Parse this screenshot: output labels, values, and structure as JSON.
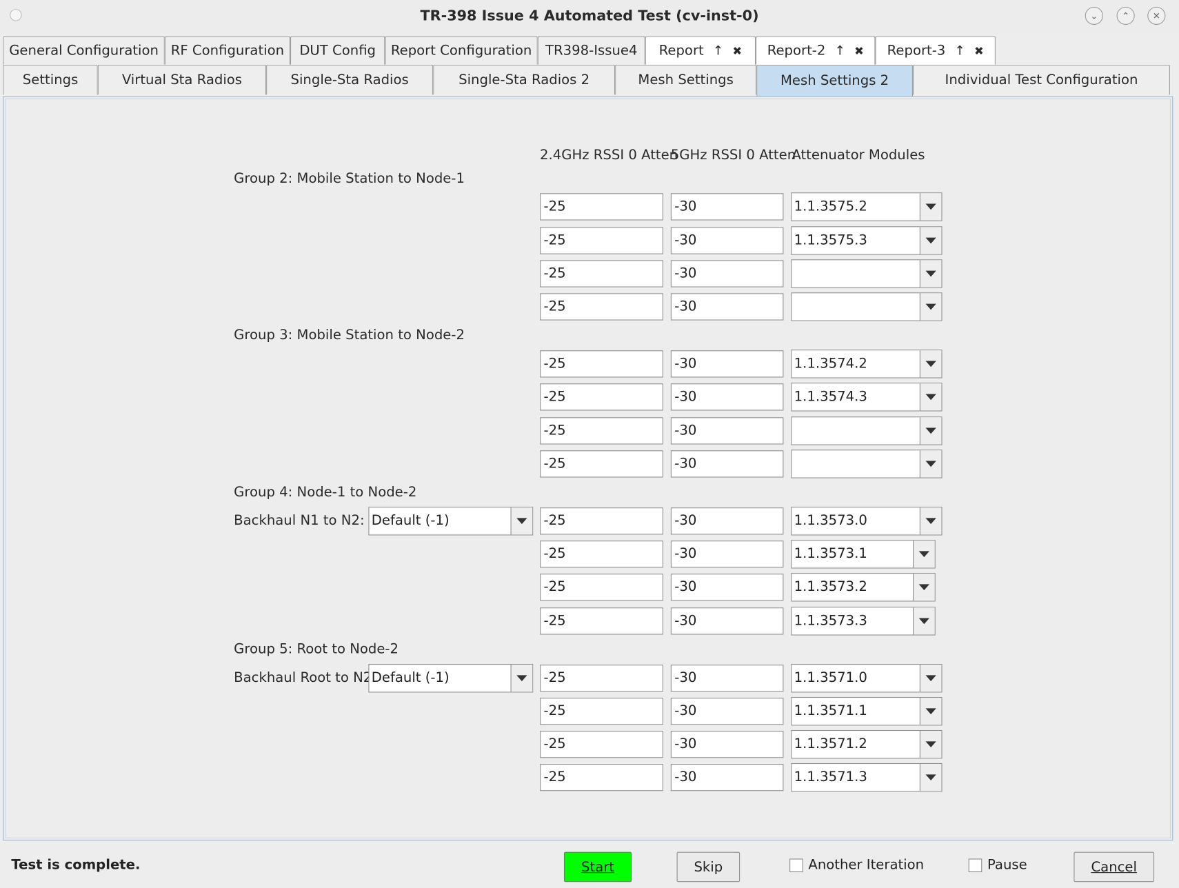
{
  "window": {
    "title": "TR-398 Issue 4 Automated Test  (cv-inst-0)"
  },
  "tabs_row1": [
    {
      "label": "General Configuration"
    },
    {
      "label": "RF Configuration"
    },
    {
      "label": "DUT Config"
    },
    {
      "label": "Report Configuration"
    },
    {
      "label": "TR398-Issue4"
    },
    {
      "label": "Report",
      "up": "↑",
      "close": "✖"
    },
    {
      "label": "Report-2",
      "up": "↑",
      "close": "✖"
    },
    {
      "label": "Report-3",
      "up": "↑",
      "close": "✖"
    }
  ],
  "tabs_row2": [
    {
      "label": "Settings"
    },
    {
      "label": "Virtual Sta Radios"
    },
    {
      "label": "Single-Sta Radios"
    },
    {
      "label": "Single-Sta Radios 2"
    },
    {
      "label": "Mesh Settings"
    },
    {
      "label": "Mesh Settings 2",
      "active": true
    },
    {
      "label": "Individual Test Configuration"
    }
  ],
  "columns": {
    "col1": "2.4GHz RSSI 0 Atten",
    "col2": "5GHz RSSI 0 Atten",
    "col3": "Attenuator Modules"
  },
  "groups": [
    {
      "label": "Group 2: Mobile Station to Node-1",
      "rows": [
        {
          "rssi24": "-25",
          "rssi5": "-30",
          "module": "1.1.3575.2"
        },
        {
          "rssi24": "-25",
          "rssi5": "-30",
          "module": "1.1.3575.3"
        },
        {
          "rssi24": "-25",
          "rssi5": "-30",
          "module": ""
        },
        {
          "rssi24": "-25",
          "rssi5": "-30",
          "module": ""
        }
      ]
    },
    {
      "label": "Group 3: Mobile Station to Node-2",
      "rows": [
        {
          "rssi24": "-25",
          "rssi5": "-30",
          "module": "1.1.3574.2"
        },
        {
          "rssi24": "-25",
          "rssi5": "-30",
          "module": "1.1.3574.3"
        },
        {
          "rssi24": "-25",
          "rssi5": "-30",
          "module": ""
        },
        {
          "rssi24": "-25",
          "rssi5": "-30",
          "module": ""
        }
      ]
    },
    {
      "label": "Group 4: Node-1 to Node-2",
      "backhaul_label": "Backhaul N1 to N2:",
      "backhaul_value": "Default (-1)",
      "rows": [
        {
          "rssi24": "-25",
          "rssi5": "-30",
          "module": "1.1.3573.0"
        },
        {
          "rssi24": "-25",
          "rssi5": "-30",
          "module": "1.1.3573.1"
        },
        {
          "rssi24": "-25",
          "rssi5": "-30",
          "module": "1.1.3573.2"
        },
        {
          "rssi24": "-25",
          "rssi5": "-30",
          "module": "1.1.3573.3"
        }
      ]
    },
    {
      "label": "Group 5: Root to Node-2",
      "backhaul_label": "Backhaul Root to N2:",
      "backhaul_value": "Default (-1)",
      "rows": [
        {
          "rssi24": "-25",
          "rssi5": "-30",
          "module": "1.1.3571.0"
        },
        {
          "rssi24": "-25",
          "rssi5": "-30",
          "module": "1.1.3571.1"
        },
        {
          "rssi24": "-25",
          "rssi5": "-30",
          "module": "1.1.3571.2"
        },
        {
          "rssi24": "-25",
          "rssi5": "-30",
          "module": "1.1.3571.3"
        }
      ]
    }
  ],
  "status": {
    "text": "Test is complete.",
    "start": "Start",
    "skip": "Skip",
    "another_iteration": "Another Iteration",
    "pause": "Pause",
    "cancel": "Cancel"
  },
  "colors": {
    "start_button": "#00ff00",
    "active_tab": "#c6dcf0"
  }
}
